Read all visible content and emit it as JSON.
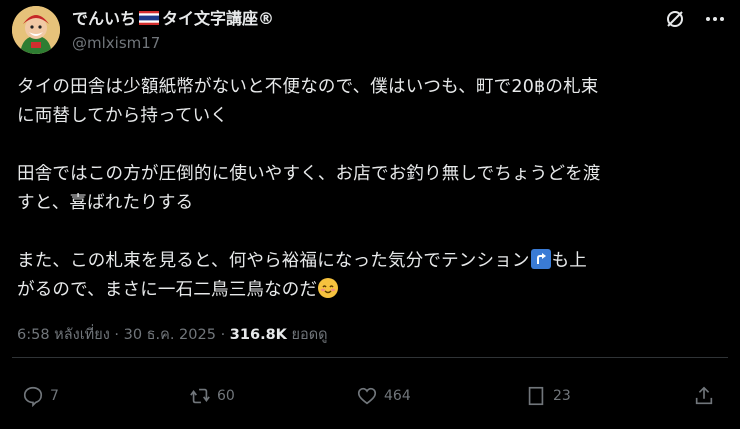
{
  "header": {
    "display_name_part1": "でんいち",
    "display_name_part2": "タイ文字講座®",
    "handle": "@mlxism17",
    "icons": [
      "avatar",
      "thailand-flag-icon",
      "grok-icon",
      "more-icon"
    ]
  },
  "tweet": {
    "lines": [
      "タイの田舎は少額紙幣がないと不便なので、僕はいつも、町で20฿の札束",
      "に両替してから持っていく",
      "田舎ではこの方が圧倒的に使いやすく、お店でお釣り無しでちょうどを渡",
      "すと、喜ばれたりする",
      "また、この札束を見ると、何やら裕福になった気分でテンション",
      "も上",
      "がるので、まさに一石二鳥三鳥なのだ"
    ],
    "emojis": [
      "arrow-up-icon",
      "smile-icon"
    ]
  },
  "meta": {
    "time": "6:58 หลังเที่ยง",
    "separator": "·",
    "date": "30 ธ.ค. 2025",
    "views_count": "316.8K",
    "views_label": "ยอดดู"
  },
  "actions": {
    "reply_count": "7",
    "retweet_count": "60",
    "like_count": "464",
    "bookmark_count": "23",
    "icons": [
      "reply-icon",
      "retweet-icon",
      "like-icon",
      "bookmark-icon",
      "share-icon"
    ]
  },
  "colors": {
    "background": "#000000",
    "text": "#e7e9ea",
    "muted": "#71767b",
    "divider": "#2f3336"
  }
}
